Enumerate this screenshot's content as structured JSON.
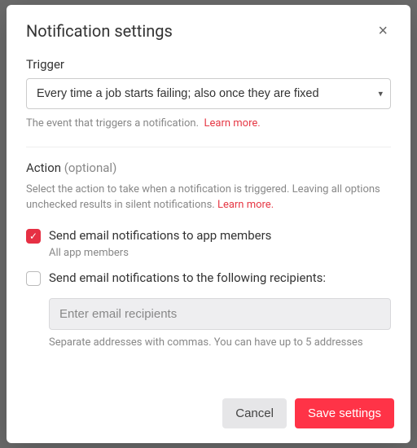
{
  "modal": {
    "title": "Notification settings",
    "closeIcon": "×"
  },
  "trigger": {
    "label": "Trigger",
    "selected": "Every time a job starts failing; also once they are fixed",
    "help": "The event that triggers a notification.",
    "learnMore": "Learn more."
  },
  "action": {
    "label": "Action",
    "optional": "(optional)",
    "desc": "Select the action to take when a notification is triggered. Leaving all options unchecked results in silent notifications.",
    "learnMore": "Learn more."
  },
  "emailMembers": {
    "label": "Send email notifications to app members",
    "sub": "All app members"
  },
  "emailRecipients": {
    "label": "Send email notifications to the following recipients:",
    "placeholder": "Enter email recipients",
    "help": "Separate addresses with commas. You can have up to 5 addresses"
  },
  "footer": {
    "cancel": "Cancel",
    "save": "Save settings"
  }
}
